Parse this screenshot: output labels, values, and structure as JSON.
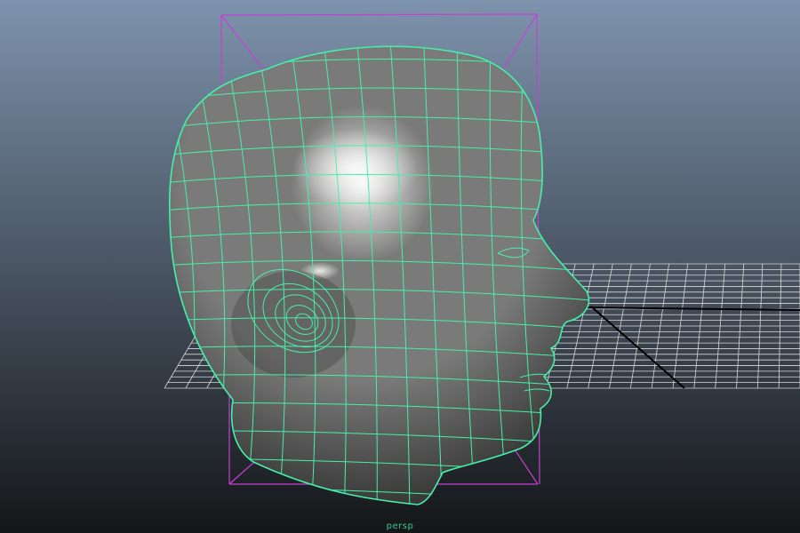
{
  "viewport": {
    "camera_label": "persp",
    "colors": {
      "background_top": "#7e93ad",
      "background_bottom": "#141618",
      "grid": "#d7d7d7",
      "grid_axis": "#000000",
      "bounding_box": "#c53fd6",
      "wireframe": "#45f0a8",
      "mesh_light": "#f2f2f2",
      "mesh_mid": "#7a7a7a",
      "mesh_dark": "#262626",
      "camera_label": "#31c98c"
    }
  },
  "object": {
    "kind": "polygon-mesh",
    "name": "head-mesh",
    "selected": true,
    "display_mode": "smooth-shade-with-wireframe"
  }
}
